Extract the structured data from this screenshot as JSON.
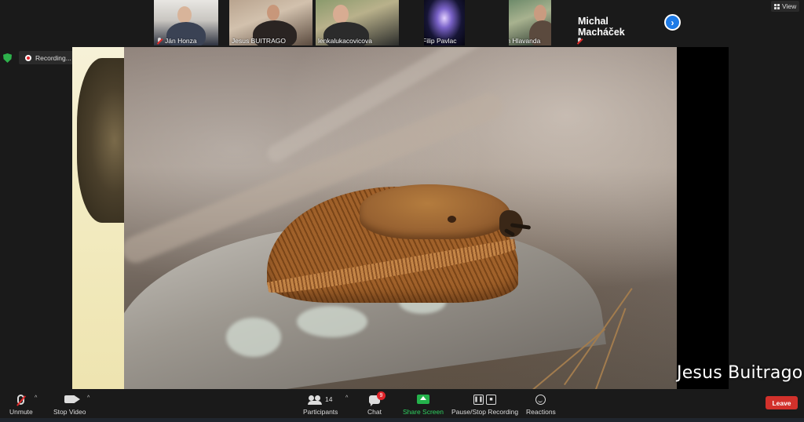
{
  "participants": [
    {
      "name": "Ján Honza",
      "muted": true
    },
    {
      "name": "Jesus BUITRAGO",
      "muted": false
    },
    {
      "name": "lenkalukacovicova",
      "muted": false
    },
    {
      "name": "Filip Pavlac",
      "muted": true
    },
    {
      "name": "Ivan Hlavanda",
      "muted": true
    }
  ],
  "name_only_tile": {
    "name": "Michal Macháček",
    "muted": true
  },
  "view_button": {
    "label": "View",
    "icon": "grid-icon"
  },
  "recording": {
    "label": "Recording...",
    "pause_glyph": "❚❚",
    "stop_glyph": "■"
  },
  "share": {
    "speaker_name": "Jesus Buitrago"
  },
  "toolbar": {
    "unmute": "Unmute",
    "stop_video": "Stop Video",
    "participants": "Participants",
    "participant_count": "14",
    "chat": "Chat",
    "chat_badge": "9",
    "share_screen": "Share Screen",
    "pause_stop_recording": "Pause/Stop Recording",
    "reactions": "Reactions",
    "leave": "Leave",
    "caret": "^",
    "next_glyph": "›",
    "pause_glyph": "❚❚",
    "stop_glyph": "■"
  },
  "colors": {
    "accent_blue": "#1d7ae6",
    "share_green": "#24b24b",
    "leave_red": "#d2312b",
    "muted_red": "#e02828",
    "background": "#1a1a1a"
  }
}
